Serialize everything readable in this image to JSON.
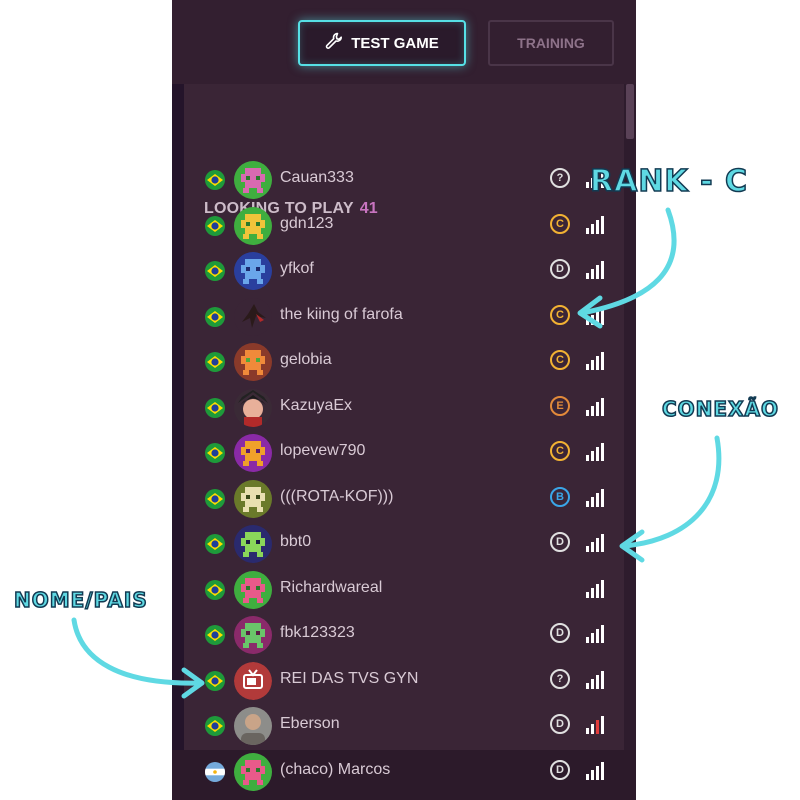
{
  "header": {
    "test_game_label": "TEST GAME",
    "training_label": "TRAINING"
  },
  "list": {
    "title": "LOOKING TO PLAY",
    "count": "41"
  },
  "colors": {
    "accent": "#56e0e6",
    "rank_gold": "#f2b233",
    "rank_blue": "#3aa6e8",
    "rank_grey": "#e0e0e0",
    "rank_orange": "#e28a3a",
    "signal_red": "#e23b3b"
  },
  "players": [
    {
      "name": "Cauan333",
      "flag": "brazil",
      "rank": "?",
      "rank_color": "#e0e0e0",
      "signal": "full",
      "avatar": "green-pixel-mask"
    },
    {
      "name": "gdn123",
      "flag": "brazil",
      "rank": "C",
      "rank_color": "#f2b233",
      "signal": "full",
      "avatar": "green-pixel-crown"
    },
    {
      "name": "yfkof",
      "flag": "brazil",
      "rank": "D",
      "rank_color": "#e0e0e0",
      "signal": "full",
      "avatar": "blue-pixel-robot"
    },
    {
      "name": "the kiing of farofa",
      "flag": "brazil",
      "rank": "C",
      "rank_color": "#f2b233",
      "signal": "full",
      "avatar": "dark-fighter-photo"
    },
    {
      "name": "gelobia",
      "flag": "brazil",
      "rank": "C",
      "rank_color": "#f2b233",
      "signal": "full",
      "avatar": "orange-pixel-robot"
    },
    {
      "name": "KazuyaEx",
      "flag": "brazil",
      "rank": "E",
      "rank_color": "#e28a3a",
      "signal": "full",
      "avatar": "anime-character"
    },
    {
      "name": "lopevew790",
      "flag": "brazil",
      "rank": "C",
      "rank_color": "#f2b233",
      "signal": "full",
      "avatar": "purple-pixel-robot"
    },
    {
      "name": "(((ROTA-KOF)))",
      "flag": "brazil",
      "rank": "B",
      "rank_color": "#3aa6e8",
      "signal": "full",
      "avatar": "olive-pixel-robot"
    },
    {
      "name": "bbt0",
      "flag": "brazil",
      "rank": "D",
      "rank_color": "#e0e0e0",
      "signal": "full",
      "avatar": "navy-pixel-robot"
    },
    {
      "name": "Richardwareal",
      "flag": "brazil",
      "rank": "",
      "rank_color": "#e0e0e0",
      "signal": "full",
      "avatar": "green-pixel-robot"
    },
    {
      "name": "fbk123323",
      "flag": "brazil",
      "rank": "D",
      "rank_color": "#e0e0e0",
      "signal": "full",
      "avatar": "magenta-pixel-robot"
    },
    {
      "name": "REI DAS TVS GYN",
      "flag": "brazil",
      "rank": "?",
      "rank_color": "#e0e0e0",
      "signal": "full",
      "avatar": "tv-icon"
    },
    {
      "name": "Eberson",
      "flag": "brazil",
      "rank": "D",
      "rank_color": "#e0e0e0",
      "signal": "weak",
      "avatar": "person-photo"
    },
    {
      "name": "(chaco) Marcos",
      "flag": "argentina",
      "rank": "D",
      "rank_color": "#e0e0e0",
      "signal": "full",
      "avatar": "green-pixel-robot"
    }
  ],
  "annotations": {
    "rank": "RANK - C",
    "connection": "CONEXÃO",
    "name_country": "NOME/PAIS"
  }
}
